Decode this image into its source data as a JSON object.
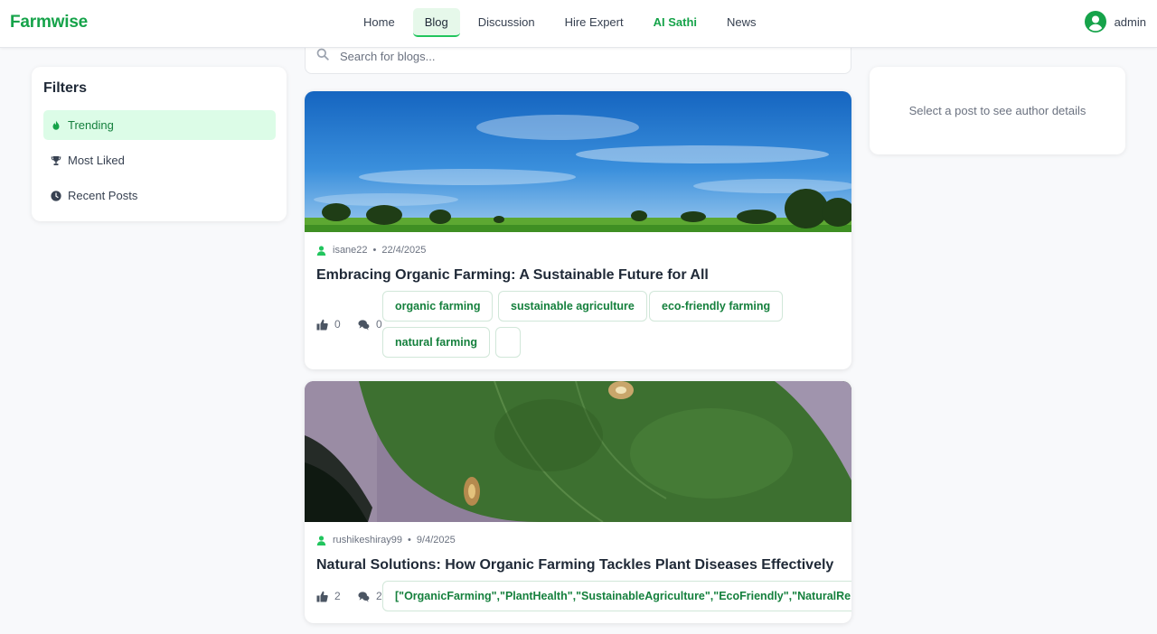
{
  "brand": "Farmwise",
  "nav": {
    "home": "Home",
    "blog": "Blog",
    "discussion": "Discussion",
    "hire_expert": "Hire Expert",
    "ai_sathi": "AI Sathi",
    "news": "News"
  },
  "user": {
    "name": "admin",
    "icon": "user-circle-icon"
  },
  "filters": {
    "title": "Filters",
    "items": [
      {
        "label": "Trending",
        "icon": "fire-icon",
        "active": true
      },
      {
        "label": "Most Liked",
        "icon": "trophy-icon",
        "active": false
      },
      {
        "label": "Recent Posts",
        "icon": "clock-icon",
        "active": false
      }
    ]
  },
  "search": {
    "placeholder": "Search for blogs...",
    "value": ""
  },
  "posts": [
    {
      "author": "isane22",
      "date": "22/4/2025",
      "title": "Embracing Organic Farming: A Sustainable Future for All",
      "likes": "0",
      "comments": "0",
      "tags": [
        "organic farming",
        "sustainable agriculture",
        "eco-friendly farming",
        "natural farming",
        ""
      ],
      "image": "sky-field-landscape"
    },
    {
      "author": "rushikeshiray99",
      "date": "9/4/2025",
      "title": "Natural Solutions: How Organic Farming Tackles Plant Diseases Effectively",
      "likes": "2",
      "comments": "2",
      "tags": [
        "[\"OrganicFarming\",\"PlantHealth\",\"SustainableAgriculture\",\"EcoFriendly\",\"NaturalRemedies\"]"
      ],
      "image": "diseased-leaf-closeup"
    }
  ],
  "author_panel": {
    "placeholder": "Select a post to see author details"
  },
  "colors": {
    "brand_green": "#16a34a",
    "active_bg": "#dcfce7",
    "tag_text": "#15803d"
  }
}
